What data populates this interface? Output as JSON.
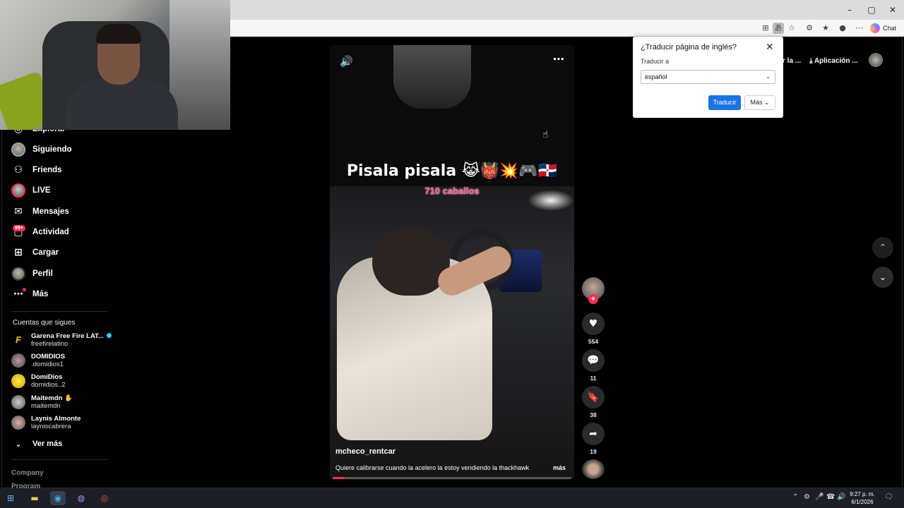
{
  "browser": {
    "window_controls": [
      "–",
      "▢",
      "✕"
    ],
    "chat_label": "Chat"
  },
  "sidebar": {
    "items": [
      {
        "label": "Explorar"
      },
      {
        "label": "Siguiendo"
      },
      {
        "label": "Friends"
      },
      {
        "label": "LIVE"
      },
      {
        "label": "Mensajes"
      },
      {
        "label": "Actividad",
        "badge": "99+"
      },
      {
        "label": "Cargar"
      },
      {
        "label": "Perfil"
      },
      {
        "label": "Más"
      }
    ],
    "follows_title": "Cuentas que sigues",
    "follows": [
      {
        "name": "Garena Free Fire LAT...",
        "handle": "freefirelatino"
      },
      {
        "name": "DOMIDIOS",
        "handle": ".domidios1"
      },
      {
        "name": "DomiDios",
        "handle": "domidios..2"
      },
      {
        "name": "Maitemdn",
        "handle": "maitemdn"
      },
      {
        "name": "Laynis Almonte",
        "handle": "layniscabrera"
      }
    ],
    "see_more": "Ver más",
    "company": "Company",
    "program": "Program"
  },
  "video": {
    "caption": "Pisala pisala 😹👹💥🎮🇩🇴",
    "subcaption": "710 caballos",
    "author": "mcheco_rentcar",
    "description": "Quiere calibrarse cuando la acelero la estoy vendiendo la thackhawk",
    "more": "más",
    "progress": 0.05
  },
  "actions": {
    "likes": "554",
    "comments": "11",
    "saves": "38",
    "shares": "19"
  },
  "topbar": {
    "left_label": "r la ...",
    "app_label": "Aplicación ..."
  },
  "translate_popup": {
    "title": "¿Traducir página de inglés?",
    "label": "Traducir a",
    "selected_language": "español",
    "translate_button": "Traducir",
    "more_button": "Más"
  },
  "taskbar": {
    "time": "9:27 p. m.",
    "date": "6/1/2026"
  }
}
